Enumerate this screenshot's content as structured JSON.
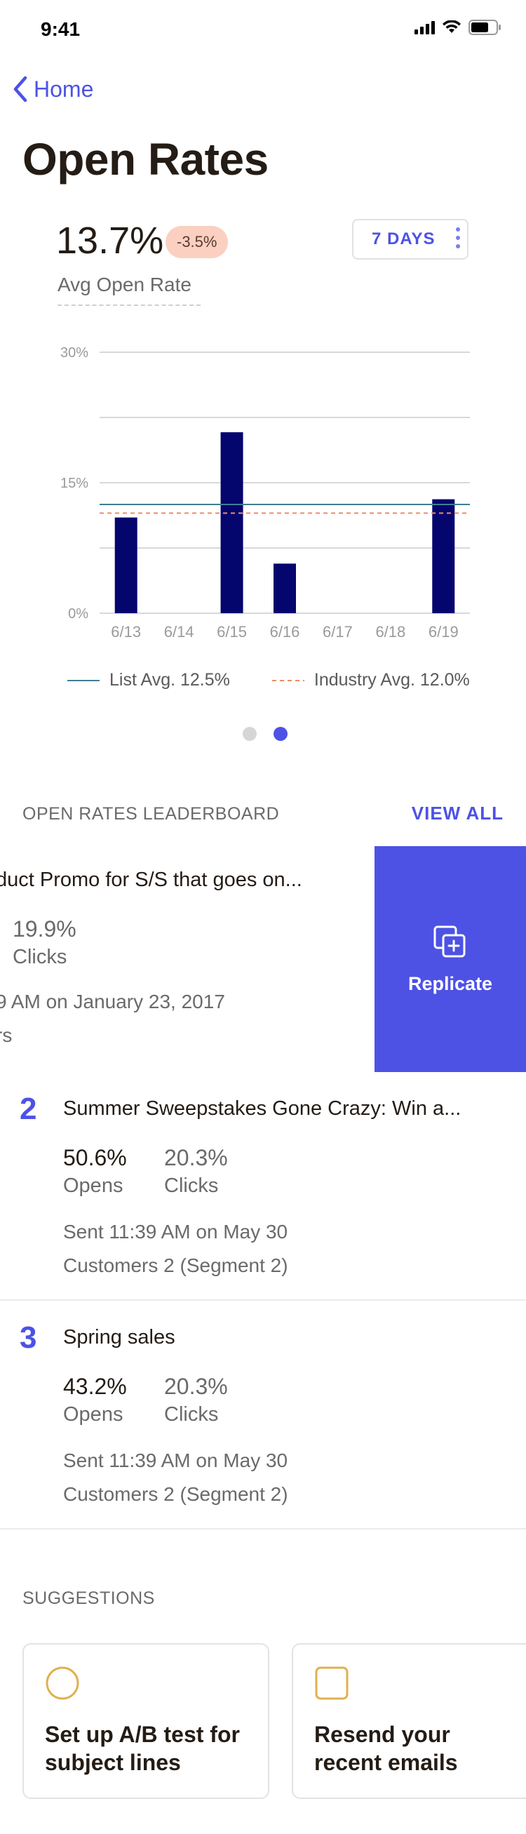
{
  "status_bar": {
    "time": "9:41"
  },
  "nav": {
    "back_label": "Home"
  },
  "page": {
    "title": "Open Rates"
  },
  "kpi": {
    "value": "13.7%",
    "change": "-3.5%",
    "label": "Avg Open Rate",
    "range_button": "7 DAYS"
  },
  "chart_data": {
    "type": "bar",
    "categories": [
      "6/13",
      "6/14",
      "6/15",
      "6/16",
      "6/17",
      "6/18",
      "6/19"
    ],
    "values": [
      11.0,
      0,
      20.8,
      5.7,
      0,
      0,
      13.1
    ],
    "ylim": [
      0,
      30
    ],
    "yticks": [
      "0%",
      "15%",
      "30%"
    ],
    "reference_lines": [
      {
        "name": "List Avg. 12.5%",
        "value": 12.5,
        "style": "solid",
        "color": "#3e7f94"
      },
      {
        "name": "Industry Avg. 12.0%",
        "value": 11.5,
        "style": "dashed",
        "color": "#f08a6a"
      }
    ],
    "bar_color": "#05056e",
    "grid": true,
    "legend_position": "bottom"
  },
  "pager": {
    "pages": 2,
    "active": 2
  },
  "leaderboard": {
    "header": "OPEN RATES LEADERBOARD",
    "view_all": "VIEW ALL",
    "swiped_item": {
      "title": "duct Promo for S/S that goes on...",
      "clicks": "19.9%",
      "clicks_label": "Clicks",
      "sent": "9 AM on January 23, 2017",
      "audience": "rs",
      "action_label": "Replicate"
    },
    "items": [
      {
        "rank": "2",
        "title": "Summer Sweepstakes Gone Crazy: Win a...",
        "opens": "50.6%",
        "opens_label": "Opens",
        "clicks": "20.3%",
        "clicks_label": "Clicks",
        "sent": "Sent 11:39 AM on May 30",
        "audience": "Customers 2 (Segment 2)"
      },
      {
        "rank": "3",
        "title": "Spring sales",
        "opens": "43.2%",
        "opens_label": "Opens",
        "clicks": "20.3%",
        "clicks_label": "Clicks",
        "sent": "Sent 11:39 AM on May 30",
        "audience": "Customers 2 (Segment 2)"
      }
    ]
  },
  "suggestions": {
    "header": "SUGGESTIONS",
    "cards": [
      {
        "line1": "Set up A/B test for",
        "line2": "subject lines",
        "icon": "circle-icon",
        "icon_color": "#e0b050"
      },
      {
        "line1": "Resend your",
        "line2": "recent emails",
        "icon": "square-icon",
        "icon_color": "#e0b050"
      }
    ]
  },
  "colors": {
    "accent": "#4d52e5",
    "badge_bg": "#fbd0c0",
    "bar": "#05056e"
  }
}
